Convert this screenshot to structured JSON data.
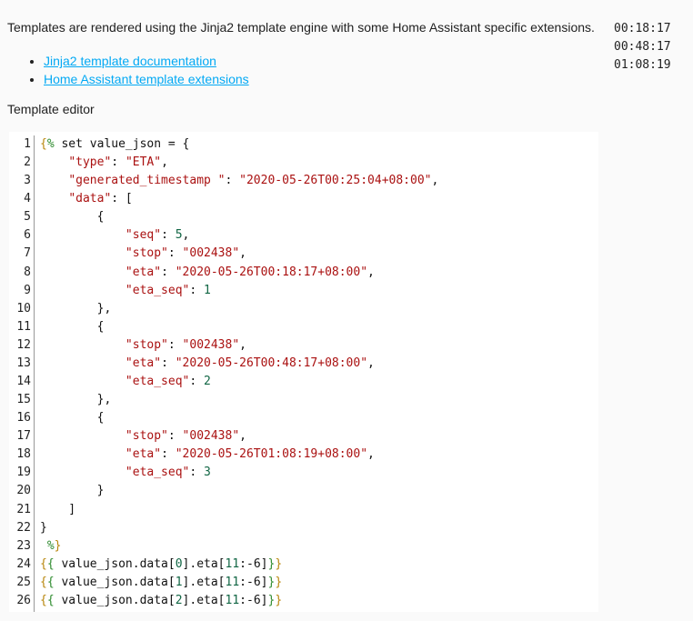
{
  "intro": "Templates are rendered using the Jinja2 template engine with some Home Assistant specific extensions.",
  "links": [
    "Jinja2 template documentation",
    "Home Assistant template extensions"
  ],
  "result": "00:18:17\n00:48:17\n01:08:19",
  "editor_label": "Template editor",
  "code_lines": [
    [
      [
        "b",
        "{"
      ],
      [
        "d",
        "%"
      ],
      [
        "p",
        " set value_json = {"
      ]
    ],
    [
      [
        "p",
        "    "
      ],
      [
        "s",
        "\"type\""
      ],
      [
        "p",
        ": "
      ],
      [
        "s",
        "\"ETA\""
      ],
      [
        "p",
        ","
      ]
    ],
    [
      [
        "p",
        "    "
      ],
      [
        "s",
        "\"generated_timestamp \""
      ],
      [
        "p",
        ": "
      ],
      [
        "s",
        "\"2020-05-26T00:25:04+08:00\""
      ],
      [
        "p",
        ","
      ]
    ],
    [
      [
        "p",
        "    "
      ],
      [
        "s",
        "\"data\""
      ],
      [
        "p",
        ": ["
      ]
    ],
    [
      [
        "p",
        "        {"
      ]
    ],
    [
      [
        "p",
        "            "
      ],
      [
        "s",
        "\"seq\""
      ],
      [
        "p",
        ": "
      ],
      [
        "n",
        "5"
      ],
      [
        "p",
        ","
      ]
    ],
    [
      [
        "p",
        "            "
      ],
      [
        "s",
        "\"stop\""
      ],
      [
        "p",
        ": "
      ],
      [
        "s",
        "\"002438\""
      ],
      [
        "p",
        ","
      ]
    ],
    [
      [
        "p",
        "            "
      ],
      [
        "s",
        "\"eta\""
      ],
      [
        "p",
        ": "
      ],
      [
        "s",
        "\"2020-05-26T00:18:17+08:00\""
      ],
      [
        "p",
        ","
      ]
    ],
    [
      [
        "p",
        "            "
      ],
      [
        "s",
        "\"eta_seq\""
      ],
      [
        "p",
        ": "
      ],
      [
        "n",
        "1"
      ]
    ],
    [
      [
        "p",
        "        },"
      ]
    ],
    [
      [
        "p",
        "        {"
      ]
    ],
    [
      [
        "p",
        "            "
      ],
      [
        "s",
        "\"stop\""
      ],
      [
        "p",
        ": "
      ],
      [
        "s",
        "\"002438\""
      ],
      [
        "p",
        ","
      ]
    ],
    [
      [
        "p",
        "            "
      ],
      [
        "s",
        "\"eta\""
      ],
      [
        "p",
        ": "
      ],
      [
        "s",
        "\"2020-05-26T00:48:17+08:00\""
      ],
      [
        "p",
        ","
      ]
    ],
    [
      [
        "p",
        "            "
      ],
      [
        "s",
        "\"eta_seq\""
      ],
      [
        "p",
        ": "
      ],
      [
        "n",
        "2"
      ]
    ],
    [
      [
        "p",
        "        },"
      ]
    ],
    [
      [
        "p",
        "        {"
      ]
    ],
    [
      [
        "p",
        "            "
      ],
      [
        "s",
        "\"stop\""
      ],
      [
        "p",
        ": "
      ],
      [
        "s",
        "\"002438\""
      ],
      [
        "p",
        ","
      ]
    ],
    [
      [
        "p",
        "            "
      ],
      [
        "s",
        "\"eta\""
      ],
      [
        "p",
        ": "
      ],
      [
        "s",
        "\"2020-05-26T01:08:19+08:00\""
      ],
      [
        "p",
        ","
      ]
    ],
    [
      [
        "p",
        "            "
      ],
      [
        "s",
        "\"eta_seq\""
      ],
      [
        "p",
        ": "
      ],
      [
        "n",
        "3"
      ]
    ],
    [
      [
        "p",
        "        }"
      ]
    ],
    [
      [
        "p",
        "    ]"
      ]
    ],
    [
      [
        "p",
        "}"
      ]
    ],
    [
      [
        "p",
        " "
      ],
      [
        "d",
        "%"
      ],
      [
        "b",
        "}"
      ]
    ],
    [
      [
        "b",
        "{"
      ],
      [
        "d",
        "{"
      ],
      [
        "p",
        " value_json.data["
      ],
      [
        "n",
        "0"
      ],
      [
        "p",
        "].eta["
      ],
      [
        "n",
        "11"
      ],
      [
        "p",
        ":-6]"
      ],
      [
        "d",
        "}"
      ],
      [
        "b",
        "}"
      ]
    ],
    [
      [
        "b",
        "{"
      ],
      [
        "d",
        "{"
      ],
      [
        "p",
        " value_json.data["
      ],
      [
        "n",
        "1"
      ],
      [
        "p",
        "].eta["
      ],
      [
        "n",
        "11"
      ],
      [
        "p",
        ":-6]"
      ],
      [
        "d",
        "}"
      ],
      [
        "b",
        "}"
      ]
    ],
    [
      [
        "b",
        "{"
      ],
      [
        "d",
        "{"
      ],
      [
        "p",
        " value_json.data["
      ],
      [
        "n",
        "2"
      ],
      [
        "p",
        "].eta["
      ],
      [
        "n",
        "11"
      ],
      [
        "p",
        ":-6]"
      ],
      [
        "d",
        "}"
      ],
      [
        "b",
        "}"
      ]
    ]
  ]
}
